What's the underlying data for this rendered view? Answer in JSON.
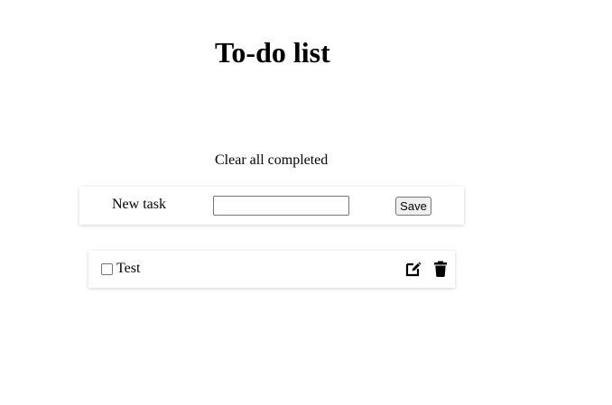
{
  "header": {
    "title": "To-do list"
  },
  "actions": {
    "clear_completed_label": "Clear all completed"
  },
  "new_task": {
    "label": "New task",
    "input_value": "",
    "save_label": "Save"
  },
  "tasks": [
    {
      "text": "Test",
      "completed": false,
      "icons": [
        "edit-icon",
        "trash-icon"
      ]
    }
  ]
}
